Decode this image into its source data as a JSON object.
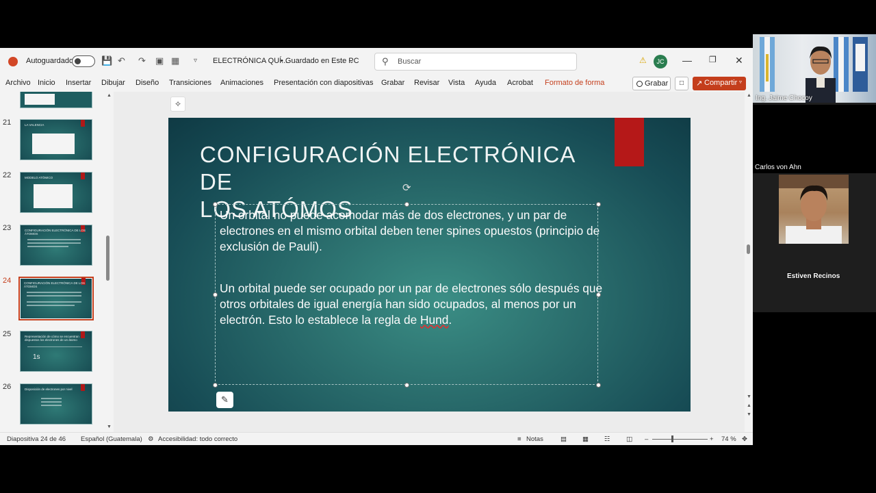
{
  "titlebar": {
    "autosave_label": "Autoguardado",
    "doc_title": "ELECTRÓNICA QUÍ...",
    "save_status": "• Guardado en Este PC",
    "search_placeholder": "Buscar",
    "user_initials": "JC"
  },
  "ribbon": {
    "tabs": [
      "Archivo",
      "Inicio",
      "Insertar",
      "Dibujar",
      "Diseño",
      "Transiciones",
      "Animaciones",
      "Presentación con diapositivas",
      "Grabar",
      "Revisar",
      "Vista",
      "Ayuda",
      "Acrobat",
      "Formato de forma"
    ],
    "record_label": "Grabar",
    "share_label": "Compartir"
  },
  "thumbnails": [
    {
      "number": "21",
      "title": "LA VALENCIA"
    },
    {
      "number": "22",
      "title": "MODELO ATÓMICO"
    },
    {
      "number": "23",
      "title": "CONFIGURACIÓN ELECTRÓNICA DE LOS ÁTOMOS"
    },
    {
      "number": "24",
      "title": "CONFIGURACIÓN ELECTRÓNICA DE LOS ÁTOMOS"
    },
    {
      "number": "25",
      "title": "Representación de cómo se encuentran dispuestos los electrones de un átomo"
    },
    {
      "number": "26",
      "title": "Disposición de electrones por nivel"
    }
  ],
  "thumb_extra": {
    "t25_big": "1s"
  },
  "slide": {
    "title": "CONFIGURACIÓN ELECTRÓNICA DE\nLOS ATÓMOS",
    "paragraph1": "Un orbital no puede acomodar más de dos electrones, y un par de electrones en el mismo orbital deben tener spines opuestos (principio de exclusión de Pauli).",
    "paragraph2_start": "Un orbital puede ser ocupado por un par de electrones sólo después que otros orbitales de igual energía han sido ocupados, al menos por un electrón. Esto lo establece la regla de ",
    "paragraph2_word": "Hund",
    "paragraph2_end": "."
  },
  "statusbar": {
    "slide_indicator": "Diapositiva 24 de 46",
    "language": "Español (Guatemala)",
    "accessibility": "Accesibilidad: todo correcto",
    "notes": "Notas",
    "zoom": "74 %"
  },
  "participants": [
    {
      "name": "Ing. Jaime Chocoy"
    },
    {
      "name": "Carlos von Ahn"
    },
    {
      "name": "Estiven Recinos"
    }
  ],
  "colors": {
    "accent": "#c43e1c",
    "slide_bg": "#2b6f6e",
    "slide_red": "#b51818"
  }
}
